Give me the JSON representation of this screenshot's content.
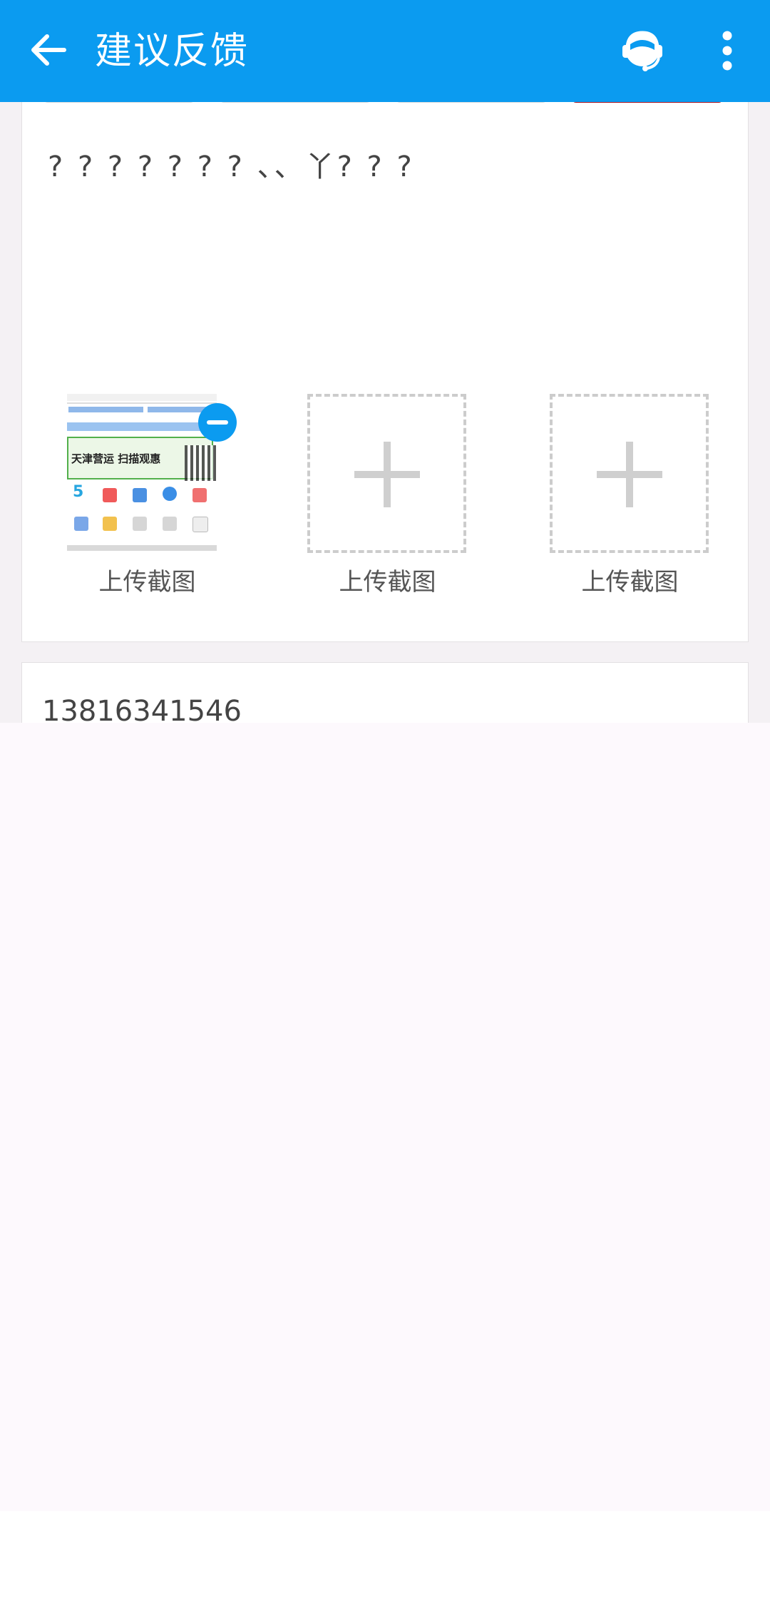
{
  "header": {
    "title": "建议反馈",
    "bg_color": "#0b9bf0"
  },
  "icons": {
    "back": "arrow-left-icon",
    "customer_service": "headset-icon",
    "more": "more-vertical-icon",
    "remove": "remove-circle-icon",
    "add": "plus-icon"
  },
  "feedback": {
    "text": "? ? ? ? ? ? ?  、、丫? ? ?",
    "screenshots": [
      {
        "label": "上传截图",
        "filled": true
      },
      {
        "label": "上传截图",
        "filled": false
      },
      {
        "label": "上传截图",
        "filled": false
      }
    ],
    "thumbnail_text": "天津营运 扫描观惠",
    "thumbnail_number": "5"
  },
  "contact": {
    "phone": "13816341546"
  }
}
